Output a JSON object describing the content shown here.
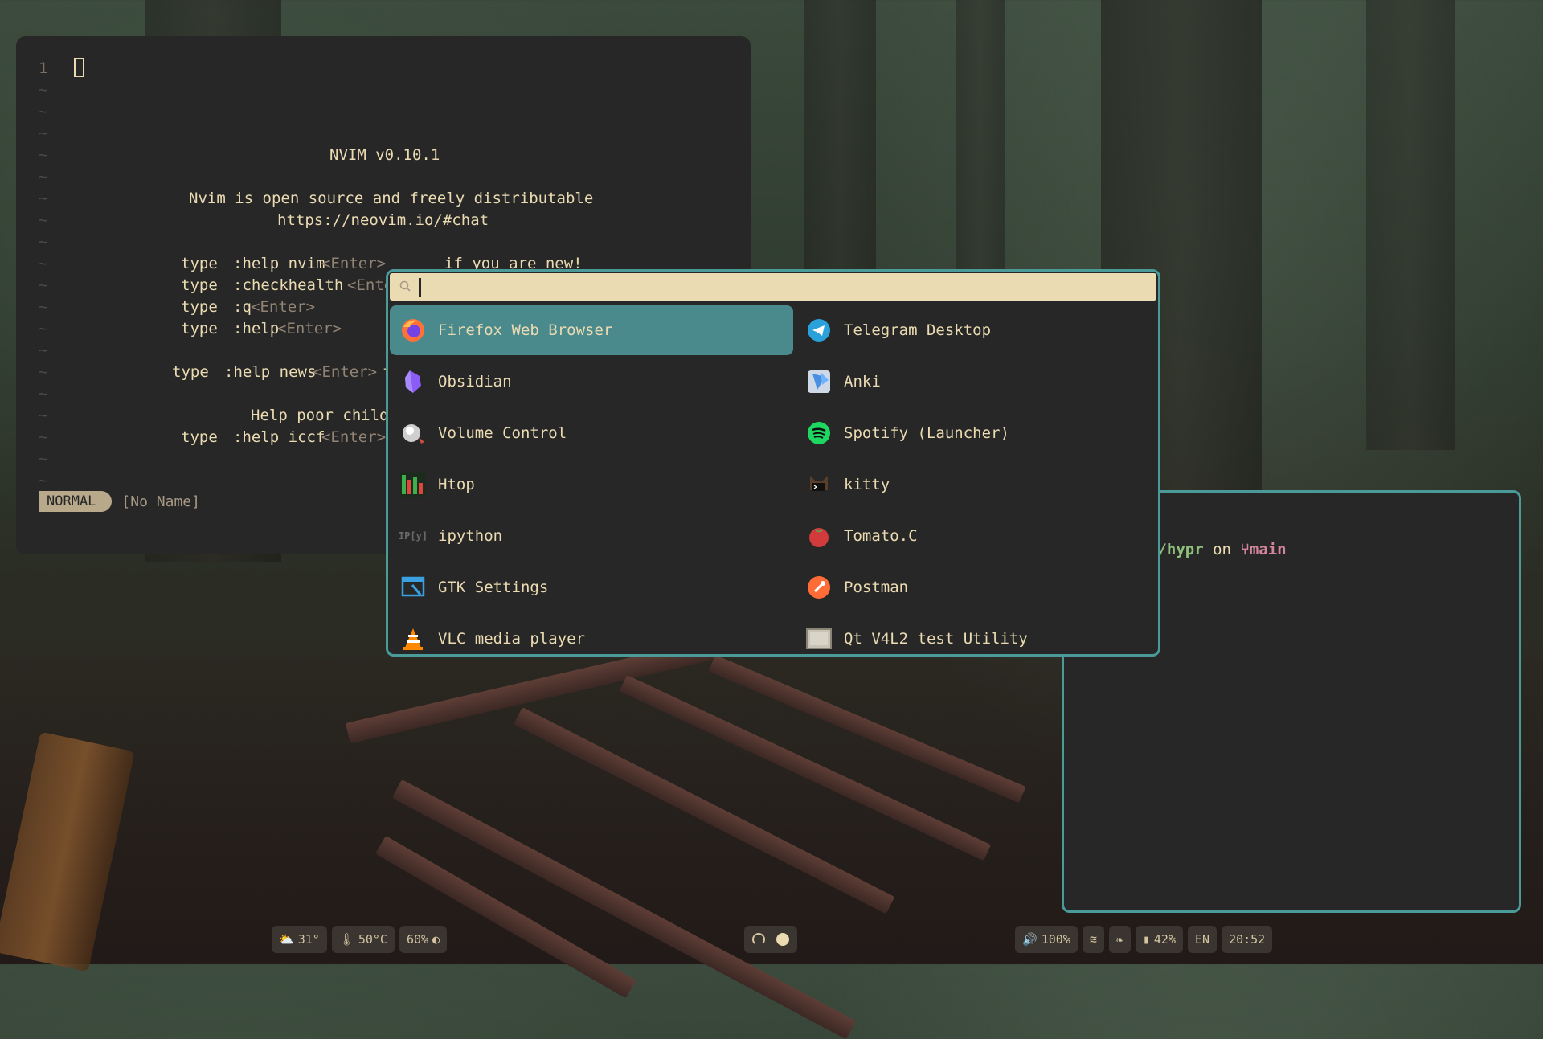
{
  "nvim": {
    "line_number": "1",
    "version": "NVIM v0.10.1",
    "intro1": "Nvim is open source and freely distributable",
    "intro2": "https://neovim.io/#chat",
    "help_rows": [
      {
        "type": "type",
        "cmd": ":help nvim",
        "key": "<Enter>",
        "desc": "if you are new!"
      },
      {
        "type": "type",
        "cmd": ":checkhealth",
        "key": "<Ente",
        "desc": ""
      },
      {
        "type": "type",
        "cmd": ":q",
        "key": "<Enter>",
        "desc": ""
      },
      {
        "type": "type",
        "cmd": ":help",
        "key": "<Enter>",
        "desc": ""
      }
    ],
    "news_type": "type",
    "news_cmd": ":help news",
    "news_key": "<Enter>",
    "news_tail": " t",
    "help_poor": "Help poor child",
    "iccf_type": "type",
    "iccf_cmd": ":help iccf",
    "iccf_key": "<Enter>",
    "mode": "NORMAL",
    "buffer": "[No Name]"
  },
  "terminal": {
    "path": "g/hypr",
    "on": "on",
    "branch": "main"
  },
  "launcher": {
    "search_value": "",
    "search_icon": "search-icon",
    "apps_left": [
      {
        "label": "Firefox Web Browser",
        "icon": "firefox-icon",
        "selected": true
      },
      {
        "label": "Obsidian",
        "icon": "obsidian-icon"
      },
      {
        "label": "Volume Control",
        "icon": "volume-control-icon"
      },
      {
        "label": "Htop",
        "icon": "htop-icon"
      },
      {
        "label": "ipython",
        "icon": "ipython-icon"
      },
      {
        "label": "GTK Settings",
        "icon": "gtk-settings-icon"
      },
      {
        "label": "VLC media player",
        "icon": "vlc-icon"
      }
    ],
    "apps_right": [
      {
        "label": "Telegram Desktop",
        "icon": "telegram-icon"
      },
      {
        "label": "Anki",
        "icon": "anki-icon"
      },
      {
        "label": "Spotify (Launcher)",
        "icon": "spotify-icon"
      },
      {
        "label": "kitty",
        "icon": "kitty-icon"
      },
      {
        "label": "Tomato.C",
        "icon": "tomato-icon"
      },
      {
        "label": "Postman",
        "icon": "postman-icon"
      },
      {
        "label": "Qt V4L2 test Utility",
        "icon": "qt-v4l2-icon"
      }
    ]
  },
  "bar": {
    "weather": "31°",
    "temp": "50°C",
    "brightness": "60%",
    "volume": "100%",
    "battery": "42%",
    "lang": "EN",
    "clock": "20:52"
  },
  "colors": {
    "accent": "#4a8a8c",
    "fg": "#ebdbb2",
    "bg": "#272727"
  }
}
